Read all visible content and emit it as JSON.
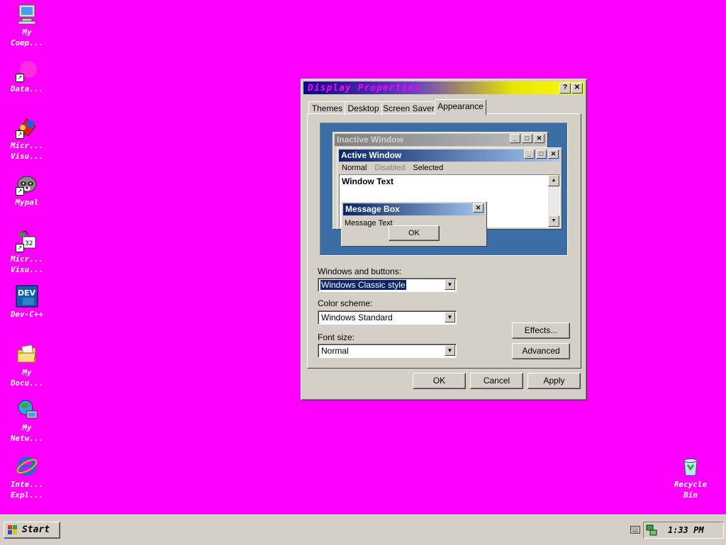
{
  "desktop": {
    "background": "#ff00ff",
    "icons": [
      {
        "label": "My\nComp...",
        "icon": "computer-icon"
      },
      {
        "label": "Data...",
        "icon": "shortcut-icon"
      },
      {
        "label": "Micr...\nVisu...",
        "icon": "visual-studio-icon"
      },
      {
        "label": "Mypal",
        "icon": "raccoon-icon"
      },
      {
        "label": "Micr...\nVisu...",
        "icon": "visual-studio-6-icon"
      },
      {
        "label": "Dev-C++",
        "icon": "dev-cpp-icon"
      },
      {
        "label": "My\nDocu...",
        "icon": "folder-icon"
      },
      {
        "label": "My\nNetw...",
        "icon": "network-icon"
      },
      {
        "label": "Inte...\nExpl...",
        "icon": "internet-explorer-icon"
      },
      {
        "label": "Recycle\nBin",
        "icon": "recycle-bin-icon"
      }
    ]
  },
  "window": {
    "title": "Display Properties",
    "help_btn": "?",
    "close_btn": "✕",
    "tabs": [
      "Themes",
      "Desktop",
      "Screen Saver",
      "Appearance"
    ],
    "active_tab": "Appearance",
    "preview": {
      "inactive_title": "Inactive Window",
      "active_title": "Active Window",
      "menu": [
        "Normal",
        "Disabled",
        "Selected"
      ],
      "window_text": "Window Text",
      "msgbox_title": "Message Box",
      "msgbox_text": "Message Text",
      "msgbox_ok": "OK"
    },
    "windows_and_buttons_label": "Windows and buttons:",
    "windows_and_buttons_value": "Windows Classic style",
    "color_scheme_label": "Color scheme:",
    "color_scheme_value": "Windows Standard",
    "font_size_label": "Font size:",
    "font_size_value": "Normal",
    "effects_btn": "Effects...",
    "advanced_btn": "Advanced",
    "ok_btn": "OK",
    "cancel_btn": "Cancel",
    "apply_btn": "Apply"
  },
  "taskbar": {
    "start_label": "Start",
    "clock": "1:33 PM"
  }
}
